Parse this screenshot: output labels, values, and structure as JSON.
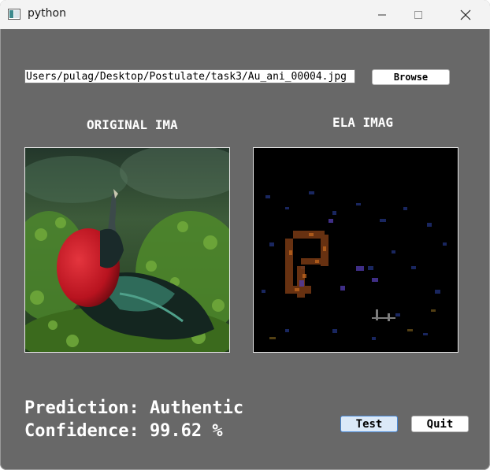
{
  "window": {
    "title": "python",
    "icons": {
      "app": "window-app-icon",
      "minimize": "minimize-icon",
      "maximize": "maximize-icon",
      "close": "close-icon"
    }
  },
  "file": {
    "path": "Users/pulag/Desktop/Postulate/task3/Au_ani_00004.jpg",
    "browse_label": "Browse"
  },
  "panels": {
    "original_title": "ORIGINAL IMA",
    "ela_title": "ELA IMAG"
  },
  "result": {
    "prediction": "Prediction: Authentic",
    "confidence": "Confidence: 99.62 %"
  },
  "buttons": {
    "test_label": "Test",
    "quit_label": "Quit"
  },
  "colors": {
    "window_bg": "#686868",
    "titlebar_bg": "#f3f3f3",
    "test_button_bg": "#dbe9f8",
    "test_button_border": "#4a89d6"
  }
}
